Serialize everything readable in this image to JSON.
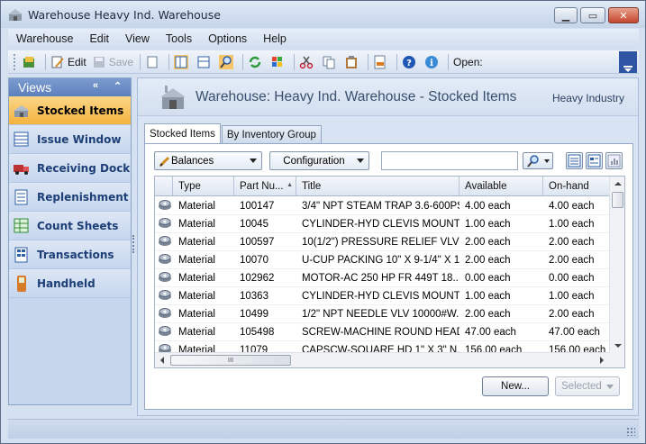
{
  "window": {
    "title": "Warehouse Heavy Ind. Warehouse"
  },
  "menu": [
    "Warehouse",
    "Edit",
    "View",
    "Tools",
    "Options",
    "Help"
  ],
  "toolbar": {
    "edit_label": "Edit",
    "save_label": "Save",
    "open_label": "Open:"
  },
  "nav": {
    "header": "Views",
    "collapse_glyph": "«",
    "pin_glyph": "⌃",
    "items": [
      {
        "label": "Stocked Items",
        "icon": "stocked-items-icon",
        "active": true
      },
      {
        "label": "Issue Window",
        "icon": "issue-window-icon"
      },
      {
        "label": "Receiving Dock",
        "icon": "truck-icon"
      },
      {
        "label": "Replenishment",
        "icon": "replenishment-icon"
      },
      {
        "label": "Count Sheets",
        "icon": "count-sheets-icon"
      },
      {
        "label": "Transactions",
        "icon": "transactions-icon"
      },
      {
        "label": "Handheld",
        "icon": "handheld-icon"
      }
    ]
  },
  "content": {
    "title": "Warehouse: Heavy Ind. Warehouse - Stocked Items",
    "subtitle": "Heavy Industry"
  },
  "tabs": [
    "Stocked Items",
    "By Inventory Group"
  ],
  "filter": {
    "view_value": "Balances",
    "config_label": "Configuration",
    "search_value": ""
  },
  "grid": {
    "columns": [
      "Type",
      "Part Nu...",
      "Title",
      "Available",
      "On-hand"
    ],
    "sort_glyph": "▲",
    "rows": [
      [
        "Material",
        "100147",
        "3/4\" NPT STEAM TRAP 3.6-600PS...",
        "4.00 each",
        "4.00 each"
      ],
      [
        "Material",
        "10045",
        "CYLINDER-HYD  CLEVIS MOUNT  ...",
        "1.00 each",
        "1.00 each"
      ],
      [
        "Material",
        "100597",
        "10(1/2\") PRESSURE RELIEF VLV 2...",
        "2.00 each",
        "2.00 each"
      ],
      [
        "Material",
        "10070",
        "U-CUP PACKING  10\" X 9-1/4\" X 1...",
        "2.00 each",
        "2.00 each"
      ],
      [
        "Material",
        "102962",
        "MOTOR-AC  250 HP  FR 449T  18...",
        "0.00 each",
        "0.00 each"
      ],
      [
        "Material",
        "10363",
        "CYLINDER-HYD  CLEVIS MOUNT  ...",
        "1.00 each",
        "1.00 each"
      ],
      [
        "Material",
        "10499",
        "1/2\" NPT NEEDLE VLV 10000#W...",
        "2.00 each",
        "2.00 each"
      ],
      [
        "Material",
        "105498",
        "SCREW-MACHINE ROUND HEAD ...",
        "47.00 each",
        "47.00 each"
      ],
      [
        "Material",
        "11079",
        "CAPSCW-SQUARE HD  1\" X 3\"  N...",
        "156.00 each",
        "156.00 each"
      ]
    ],
    "hscroll_thumb_glyph": "III"
  },
  "buttons": {
    "new_label": "New...",
    "selected_label": "Selected"
  },
  "colors": {
    "accent_active": "#f6b23e",
    "nav_text": "#1d3e77",
    "header_blue": "#5c80bd"
  }
}
